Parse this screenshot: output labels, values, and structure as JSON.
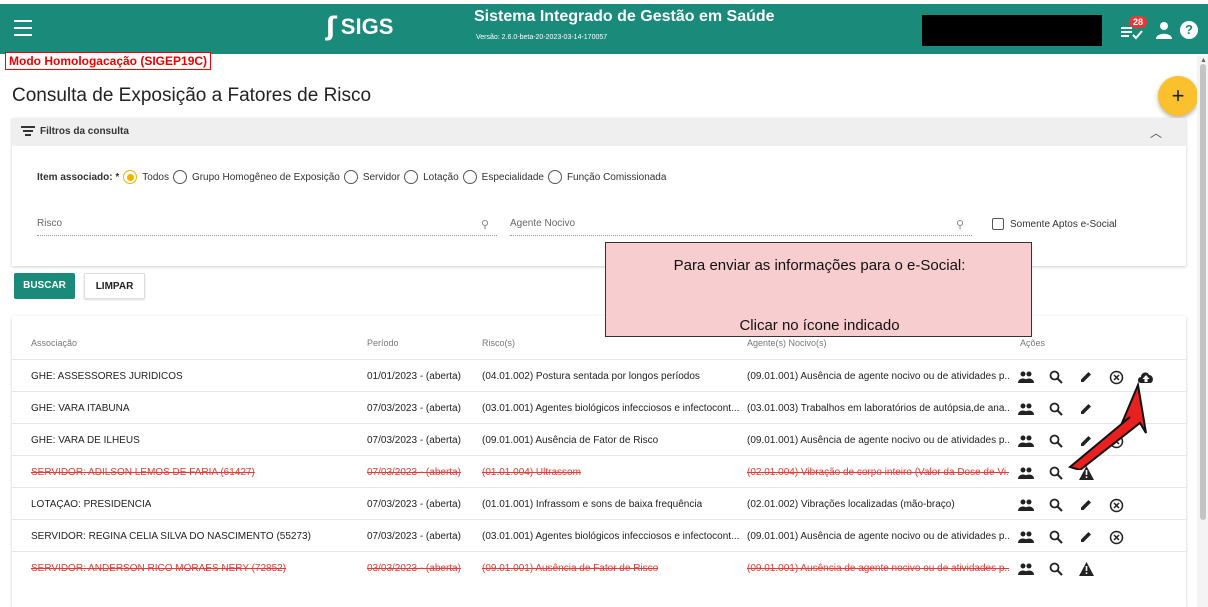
{
  "header": {
    "logo_mark": "ʃ",
    "logo_text": "SIGS",
    "system_title": "Sistema Integrado de Gestão em Saúde",
    "version": "Versão: 2.6.0-beta-20-2023-03-14-170057",
    "notifications_count": "28",
    "help_label": "?"
  },
  "environment_label": "Modo Homologacação (SIGEP19C)",
  "page": {
    "title": "Consulta de Exposição a Fatores de Risco",
    "fab_label": "+"
  },
  "filters": {
    "header_label": "Filtros da consulta",
    "item_assoc_label": "Item associado: *",
    "options": [
      "Todos",
      "Grupo Homogêneo de Exposição",
      "Servidor",
      "Lotação",
      "Especialidade",
      "Função Comissionada"
    ],
    "selected_option": "Todos",
    "risco_placeholder": "Risco",
    "agente_placeholder": "Agente Nocivo",
    "checkbox_label": "Somente Aptos e-Social"
  },
  "buttons": {
    "buscar": "BUSCAR",
    "limpar": "LIMPAR"
  },
  "table": {
    "columns": [
      "Associação",
      "Período",
      "Risco(s)",
      "Agente(s) Nocivo(s)",
      "Ações"
    ],
    "rows": [
      {
        "assoc": "GHE: ASSESSORES JURÍDICOS",
        "periodo": "01/01/2023 - (aberta)",
        "risco": "(04.01.002) Postura sentada por longos períodos",
        "agente": "(09.01.001) Ausência de agente nocivo ou de atividades p...",
        "struck": false,
        "actions": [
          "group-icon",
          "search-icon",
          "edit-icon",
          "cancel-icon",
          "cloud-upload-icon"
        ]
      },
      {
        "assoc": "GHE: VARA ITABUNA",
        "periodo": "07/03/2023 - (aberta)",
        "risco": "(03.01.001) Agentes biológicos infecciosos e infectocont...",
        "agente": "(03.01.003) Trabalhos em laboratórios de autópsia,de ana...",
        "struck": false,
        "actions": [
          "group-icon",
          "search-icon",
          "edit-icon"
        ]
      },
      {
        "assoc": "GHE: VARA DE ILHEUS",
        "periodo": "07/03/2023 - (aberta)",
        "risco": "(09.01.001) Ausência de Fator de Risco",
        "agente": "(09.01.001) Ausência de agente nocivo ou de atividades p...",
        "struck": false,
        "actions": [
          "group-icon",
          "search-icon",
          "edit-icon",
          "cancel-icon"
        ]
      },
      {
        "assoc": "SERVIDOR: ADILSON LEMOS DE FARIA (61427)",
        "periodo": "07/03/2023 - (aberta)",
        "risco": "(01.01.004) Ultrassom",
        "agente": "(02.01.004) Vibração de corpo inteiro (Valor da Dose de Vi...",
        "struck": true,
        "actions": [
          "group-icon",
          "search-icon",
          "warning-icon"
        ]
      },
      {
        "assoc": "LOTAÇÃO: PRESIDÊNCIA",
        "periodo": "07/03/2023 - (aberta)",
        "risco": "(01.01.001) Infrassom e sons de baixa frequência",
        "agente": "(02.01.002) Vibrações localizadas (mão-braço)",
        "struck": false,
        "actions": [
          "group-icon",
          "search-icon",
          "edit-icon",
          "cancel-icon"
        ]
      },
      {
        "assoc": "SERVIDOR: REGINA CELIA SILVA DO NASCIMENTO (55273)",
        "periodo": "07/03/2023 - (aberta)",
        "risco": "(03.01.001) Agentes biológicos infecciosos e infectocont...",
        "agente": "(09.01.001) Ausência de agente nocivo ou de atividades p...",
        "struck": false,
        "actions": [
          "group-icon",
          "search-icon",
          "edit-icon",
          "cancel-icon"
        ]
      },
      {
        "assoc": "SERVIDOR: ANDERSON RICO MORAES NERY (72852)",
        "periodo": "03/03/2023 - (aberta)",
        "risco": "(09.01.001) Ausência de Fator de Risco",
        "agente": "(09.01.001) Ausência de agente nocivo ou de atividades p...",
        "struck": true,
        "actions": [
          "group-icon",
          "search-icon",
          "warning-icon"
        ]
      }
    ]
  },
  "callout": {
    "line1": "Para enviar as informações para o e-Social:",
    "line2": "Clicar no ícone indicado"
  },
  "colors": {
    "primary": "#1a8a7a",
    "accent": "#fbc02d",
    "strike": "#e53935",
    "callout_bg": "#f7cdd0",
    "arrow": "#e82020"
  }
}
